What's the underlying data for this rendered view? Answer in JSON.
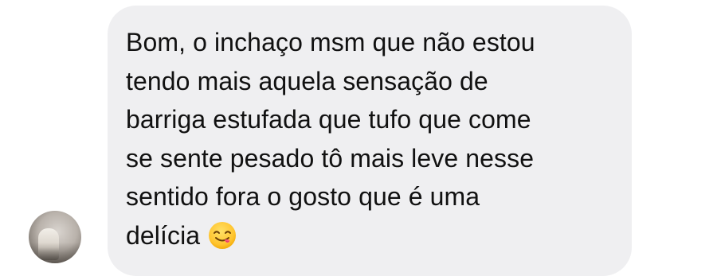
{
  "message": {
    "lines": [
      "Bom, o inchaço msm que não estou",
      "tendo mais aquela sensação de",
      "barriga estufada que tufo que come",
      "se sente pesado tô mais leve nesse",
      "sentido fora o gosto que é uma",
      "delícia"
    ],
    "emoji": "face-savoring-food-icon"
  },
  "colors": {
    "bubble": "#efeff1",
    "text": "#111111",
    "background": "#ffffff"
  }
}
